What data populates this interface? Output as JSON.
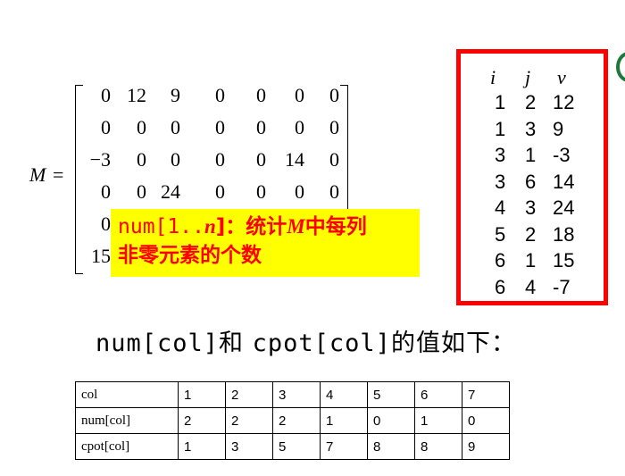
{
  "matrix": {
    "label": "M",
    "equals": "=",
    "rows": [
      [
        "0",
        "12",
        "9",
        "0",
        "0",
        "0",
        "0"
      ],
      [
        "0",
        "0",
        "0",
        "0",
        "0",
        "0",
        "0"
      ],
      [
        "−3",
        "0",
        "0",
        "0",
        "0",
        "14",
        "0"
      ],
      [
        "0",
        "0",
        "24",
        "0",
        "0",
        "0",
        "0"
      ],
      [
        "0",
        "",
        "",
        "",
        "",
        "",
        ""
      ],
      [
        "15",
        "",
        "",
        "",
        "",
        "",
        ""
      ]
    ]
  },
  "note": {
    "line1_prefix": "num[1..",
    "line1_var": "n",
    "line1_mid": "]：统计",
    "line1_var2": "M",
    "line1_suffix": "中每列",
    "line2": "非零元素的个数"
  },
  "triple": {
    "headers": [
      "i",
      "j",
      "v"
    ],
    "rows": [
      [
        "1",
        "2",
        "12"
      ],
      [
        "1",
        "3",
        "9"
      ],
      [
        "3",
        "1",
        "-3"
      ],
      [
        "3",
        "6",
        "14"
      ],
      [
        "4",
        "3",
        "24"
      ],
      [
        "5",
        "2",
        "18"
      ],
      [
        "6",
        "1",
        "15"
      ],
      [
        "6",
        "4",
        "-7"
      ]
    ]
  },
  "caption": {
    "part1": "num[col]",
    "part2": "和 ",
    "part3": "cpot[col]",
    "part4": "的值如下："
  },
  "table": {
    "rows": [
      {
        "label": "col",
        "values": [
          "1",
          "2",
          "3",
          "4",
          "5",
          "6",
          "7"
        ]
      },
      {
        "label": "num[col]",
        "values": [
          "2",
          "2",
          "2",
          "1",
          "0",
          "1",
          "0"
        ]
      },
      {
        "label": "cpot[col]",
        "values": [
          "1",
          "3",
          "5",
          "7",
          "8",
          "8",
          "9"
        ]
      }
    ]
  }
}
